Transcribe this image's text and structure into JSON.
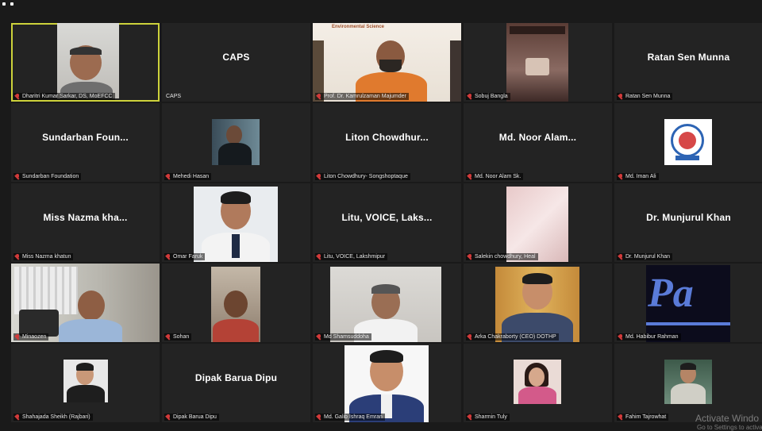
{
  "meeting": {
    "tiles": [
      {
        "label": "Dharitri Kumar Sarkar, DS, MoEFCC",
        "center": "",
        "kind": "video"
      },
      {
        "label": "CAPS",
        "center": "CAPS",
        "kind": "name"
      },
      {
        "label": "Prof. Dr. Kamrulzaman Majumder",
        "center": "",
        "kind": "video",
        "wall_text": "Environmental Science"
      },
      {
        "label": "Sobuj Bangla",
        "center": "",
        "kind": "video"
      },
      {
        "label": "Ratan Sen Munna",
        "center": "Ratan Sen Munna",
        "kind": "name"
      },
      {
        "label": "Sundarban Foundation",
        "center": "Sundarban Foun...",
        "kind": "name"
      },
      {
        "label": "Mehedi Hasan",
        "center": "",
        "kind": "photo"
      },
      {
        "label": "Liton Chowdhury- Songshoptaque",
        "center": "Liton Chowdhur...",
        "kind": "name"
      },
      {
        "label": "Md. Noor Alam Sk.",
        "center": "Md. Noor Alam...",
        "kind": "name"
      },
      {
        "label": "Md. Iman Ali",
        "center": "",
        "kind": "logo"
      },
      {
        "label": "Miss Nazma khatun",
        "center": "Miss Nazma kha...",
        "kind": "name"
      },
      {
        "label": "Omar Faruk",
        "center": "",
        "kind": "photo"
      },
      {
        "label": "Litu, VOICE, Lakshmipur",
        "center": "Litu, VOICE, Laks...",
        "kind": "name"
      },
      {
        "label": "Salekin chowdhury, Heal",
        "center": "",
        "kind": "photo"
      },
      {
        "label": "Dr. Munjurul Khan",
        "center": "Dr. Munjurul Khan",
        "kind": "name"
      },
      {
        "label": "Minaozen",
        "center": "",
        "kind": "video"
      },
      {
        "label": "Sohan",
        "center": "",
        "kind": "video"
      },
      {
        "label": "Md Shamsuddoha",
        "center": "",
        "kind": "video"
      },
      {
        "label": "Arka Chakraborty (CEO) DOTHP",
        "center": "",
        "kind": "photo"
      },
      {
        "label": "Md. Habibur Rahman",
        "center": "",
        "kind": "logo",
        "logo_text": "Pa"
      },
      {
        "label": "Shahajada Sheikh (Rajbari)",
        "center": "",
        "kind": "photo"
      },
      {
        "label": "Dipak Barua Dipu",
        "center": "Dipak Barua Dipu",
        "kind": "name"
      },
      {
        "label": "Md. Galib Ishraq Emran",
        "center": "",
        "kind": "photo"
      },
      {
        "label": "Sharmin Tuly",
        "center": "",
        "kind": "photo"
      },
      {
        "label": "Fahim Tajrowhat",
        "center": "",
        "kind": "photo"
      }
    ]
  },
  "watermark": {
    "line1": "Activate Windo",
    "line2": "Go to Settings to activate"
  }
}
